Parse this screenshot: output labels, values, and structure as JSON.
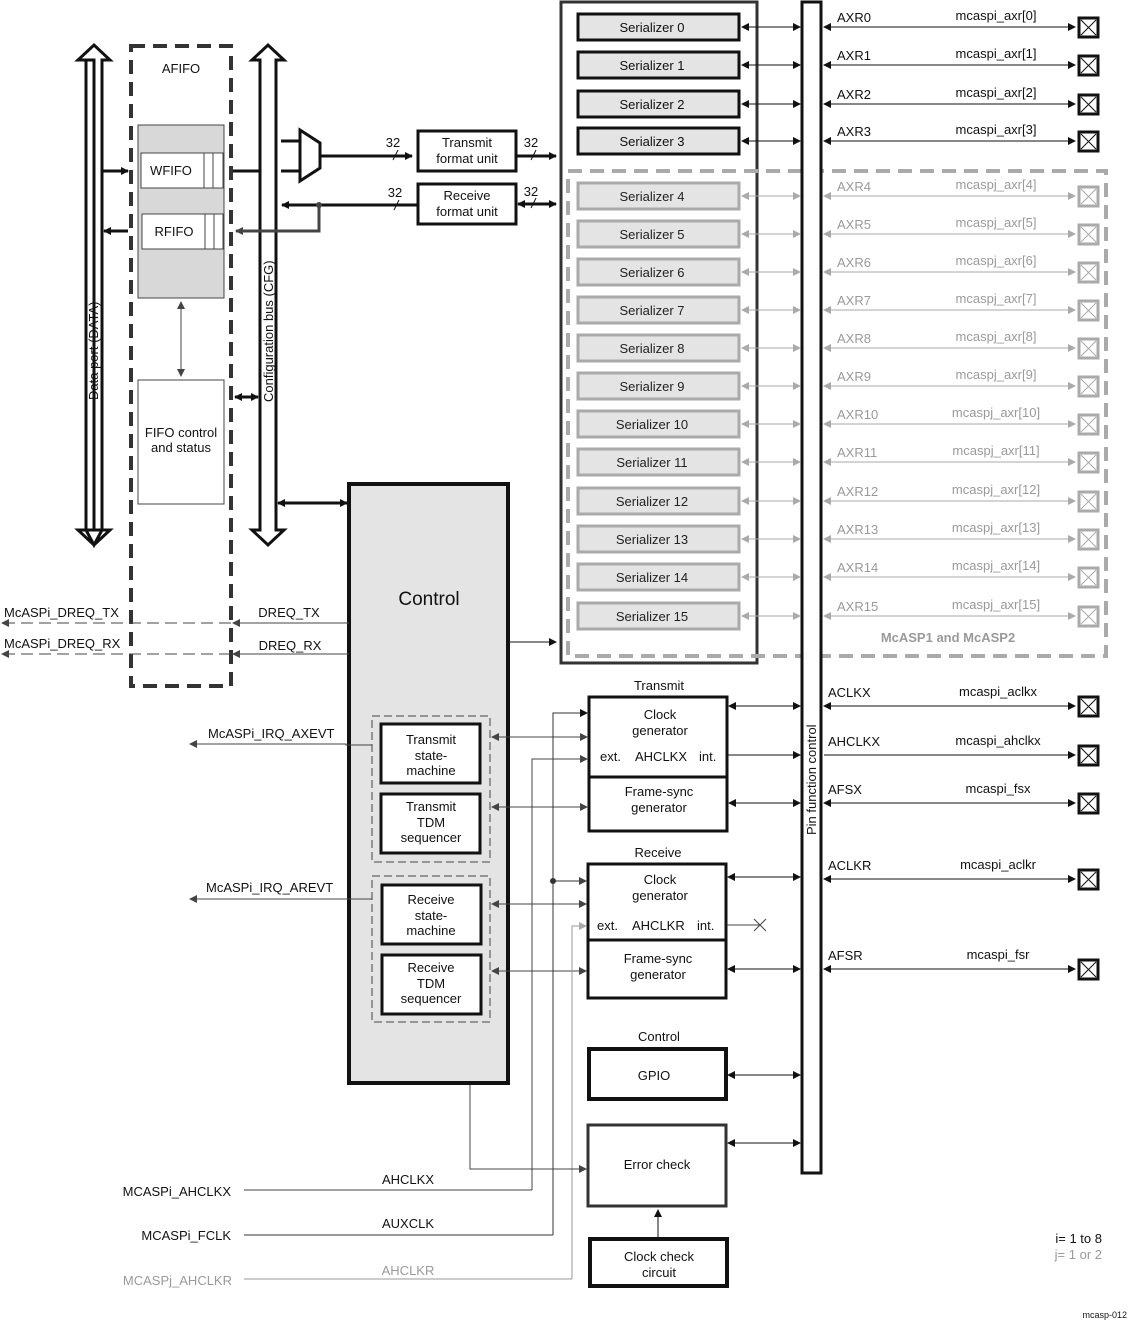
{
  "afifo": {
    "title": "AFIFO",
    "wfifo": "WFIFO",
    "rfifo": "RFIFO",
    "fifo_control_line1": "FIFO control",
    "fifo_control_line2": "and status"
  },
  "buses": {
    "data_port": "Data port (DATA)",
    "config_bus": "Configuration bus (CFG)",
    "pin_function": "Pin function control"
  },
  "format_units": {
    "transmit_line1": "Transmit",
    "transmit_line2": "format unit",
    "receive_line1": "Receive",
    "receive_line2": "format unit",
    "width_label": "32"
  },
  "serializers": [
    {
      "label": "Serializer 0",
      "axr": "AXR0",
      "pin": "mcaspi_axr[0]",
      "optional": false
    },
    {
      "label": "Serializer 1",
      "axr": "AXR1",
      "pin": "mcaspi_axr[1]",
      "optional": false
    },
    {
      "label": "Serializer 2",
      "axr": "AXR2",
      "pin": "mcaspi_axr[2]",
      "optional": false
    },
    {
      "label": "Serializer 3",
      "axr": "AXR3",
      "pin": "mcaspi_axr[3]",
      "optional": false
    },
    {
      "label": "Serializer 4",
      "axr": "AXR4",
      "pin": "mcaspj_axr[4]",
      "optional": true
    },
    {
      "label": "Serializer 5",
      "axr": "AXR5",
      "pin": "mcaspj_axr[5]",
      "optional": true
    },
    {
      "label": "Serializer 6",
      "axr": "AXR6",
      "pin": "mcaspj_axr[6]",
      "optional": true
    },
    {
      "label": "Serializer 7",
      "axr": "AXR7",
      "pin": "mcaspj_axr[7]",
      "optional": true
    },
    {
      "label": "Serializer 8",
      "axr": "AXR8",
      "pin": "mcaspj_axr[8]",
      "optional": true
    },
    {
      "label": "Serializer 9",
      "axr": "AXR9",
      "pin": "mcaspj_axr[9]",
      "optional": true
    },
    {
      "label": "Serializer 10",
      "axr": "AXR10",
      "pin": "mcaspj_axr[10]",
      "optional": true
    },
    {
      "label": "Serializer 11",
      "axr": "AXR11",
      "pin": "mcaspj_axr[11]",
      "optional": true
    },
    {
      "label": "Serializer 12",
      "axr": "AXR12",
      "pin": "mcaspj_axr[12]",
      "optional": true
    },
    {
      "label": "Serializer 13",
      "axr": "AXR13",
      "pin": "mcaspj_axr[13]",
      "optional": true
    },
    {
      "label": "Serializer 14",
      "axr": "AXR14",
      "pin": "mcaspj_axr[14]",
      "optional": true
    },
    {
      "label": "Serializer 15",
      "axr": "AXR15",
      "pin": "mcaspj_axr[15]",
      "optional": true
    }
  ],
  "optional_group_label": "McASP1 and McASP2",
  "control": {
    "title": "Control",
    "tx_state_machine": [
      "Transmit",
      "state-",
      "machine"
    ],
    "tx_tdm": [
      "Transmit",
      "TDM",
      "sequencer"
    ],
    "rx_state_machine": [
      "Receive",
      "state-",
      "machine"
    ],
    "rx_tdm": [
      "Receive",
      "TDM",
      "sequencer"
    ]
  },
  "dma_signals": {
    "dreq_tx_ext": "McASPi_DREQ_TX",
    "dreq_rx_ext": "McASPi_DREQ_RX",
    "dreq_tx": "DREQ_TX",
    "dreq_rx": "DREQ_RX",
    "irq_axevt": "McASPi_IRQ_AXEVT",
    "irq_arevt": "McASPi_IRQ_AREVT"
  },
  "transmit_clock": {
    "section": "Transmit",
    "clock_gen_line1": "Clock",
    "clock_gen_line2": "generator",
    "ext": "ext.",
    "ahclk": "AHCLKX",
    "int": "int.",
    "fs_line1": "Frame-sync",
    "fs_line2": "generator"
  },
  "receive_clock": {
    "section": "Receive",
    "clock_gen_line1": "Clock",
    "clock_gen_line2": "generator",
    "ext": "ext.",
    "ahclk": "AHCLKR",
    "int": "int.",
    "fs_line1": "Frame-sync",
    "fs_line2": "generator"
  },
  "clock_pins": [
    {
      "signal": "ACLKX",
      "pin": "mcaspi_aclkx"
    },
    {
      "signal": "AHCLKX",
      "pin": "mcaspi_ahclkx"
    },
    {
      "signal": "AFSX",
      "pin": "mcaspi_fsx"
    },
    {
      "signal": "ACLKR",
      "pin": "mcaspi_aclkr"
    },
    {
      "signal": "AFSR",
      "pin": "mcaspi_fsr"
    }
  ],
  "gpio": {
    "section": "Control",
    "label": "GPIO"
  },
  "error_check": {
    "label": "Error check"
  },
  "clock_check": {
    "line1": "Clock check",
    "line2": "circuit"
  },
  "clock_inputs": [
    {
      "ext": "MCASPi_AHCLKX",
      "int": "AHCLKX",
      "optional": false
    },
    {
      "ext": "MCASPi_FCLK",
      "int": "AUXCLK",
      "optional": false
    },
    {
      "ext": "MCASPj_AHCLKR",
      "int": "AHCLKR",
      "optional": true
    }
  ],
  "legend": {
    "i_range": "i= 1 to 8",
    "j_range": "j= 1 or 2"
  },
  "figure_id": "mcasp-012"
}
